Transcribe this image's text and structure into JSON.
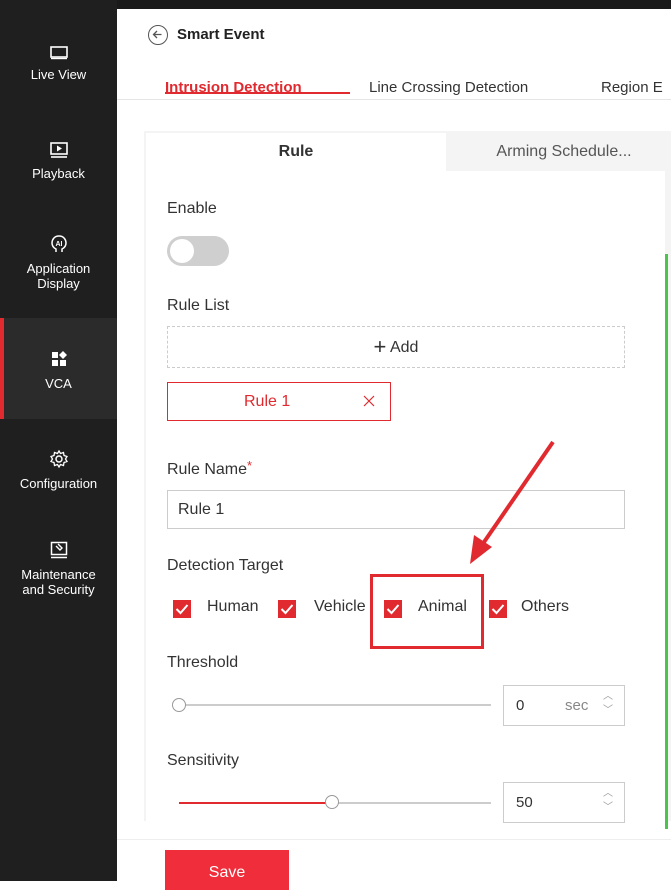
{
  "sidebar": {
    "items": [
      {
        "label": "Live View",
        "icon": "monitor-icon"
      },
      {
        "label": "Playback",
        "icon": "playback-icon"
      },
      {
        "label_line1": "Application",
        "label_line2": "Display",
        "icon": "ai-icon"
      },
      {
        "label": "VCA",
        "icon": "vca-icon",
        "active": true
      },
      {
        "label": "Configuration",
        "icon": "gear-icon"
      },
      {
        "label_line1": "Maintenance",
        "label_line2": "and Security",
        "icon": "maintenance-icon"
      }
    ]
  },
  "header": {
    "title": "Smart Event"
  },
  "tabs": [
    "Intrusion Detection",
    "Line Crossing Detection",
    "Region E"
  ],
  "subtabs": {
    "rule": "Rule",
    "arming": "Arming Schedule..."
  },
  "form": {
    "enable_label": "Enable",
    "enable_on": false,
    "rule_list_label": "Rule List",
    "add_label": "Add",
    "rule_chip": "Rule 1",
    "rule_name_label": "Rule Name",
    "required_mark": "*",
    "rule_name_value": "Rule 1",
    "detection_target_label": "Detection Target",
    "targets": [
      {
        "label": "Human",
        "checked": true
      },
      {
        "label": "Vehicle",
        "checked": true
      },
      {
        "label": "Animal",
        "checked": true
      },
      {
        "label": "Others",
        "checked": true
      }
    ],
    "threshold_label": "Threshold",
    "threshold_value": "0",
    "threshold_unit": "sec",
    "sensitivity_label": "Sensitivity",
    "sensitivity_value": "50"
  },
  "footer": {
    "save_label": "Save"
  },
  "colors": {
    "accent": "#e02a2f",
    "sidebar": "#1f1f1f",
    "green": "#4cc34c"
  }
}
